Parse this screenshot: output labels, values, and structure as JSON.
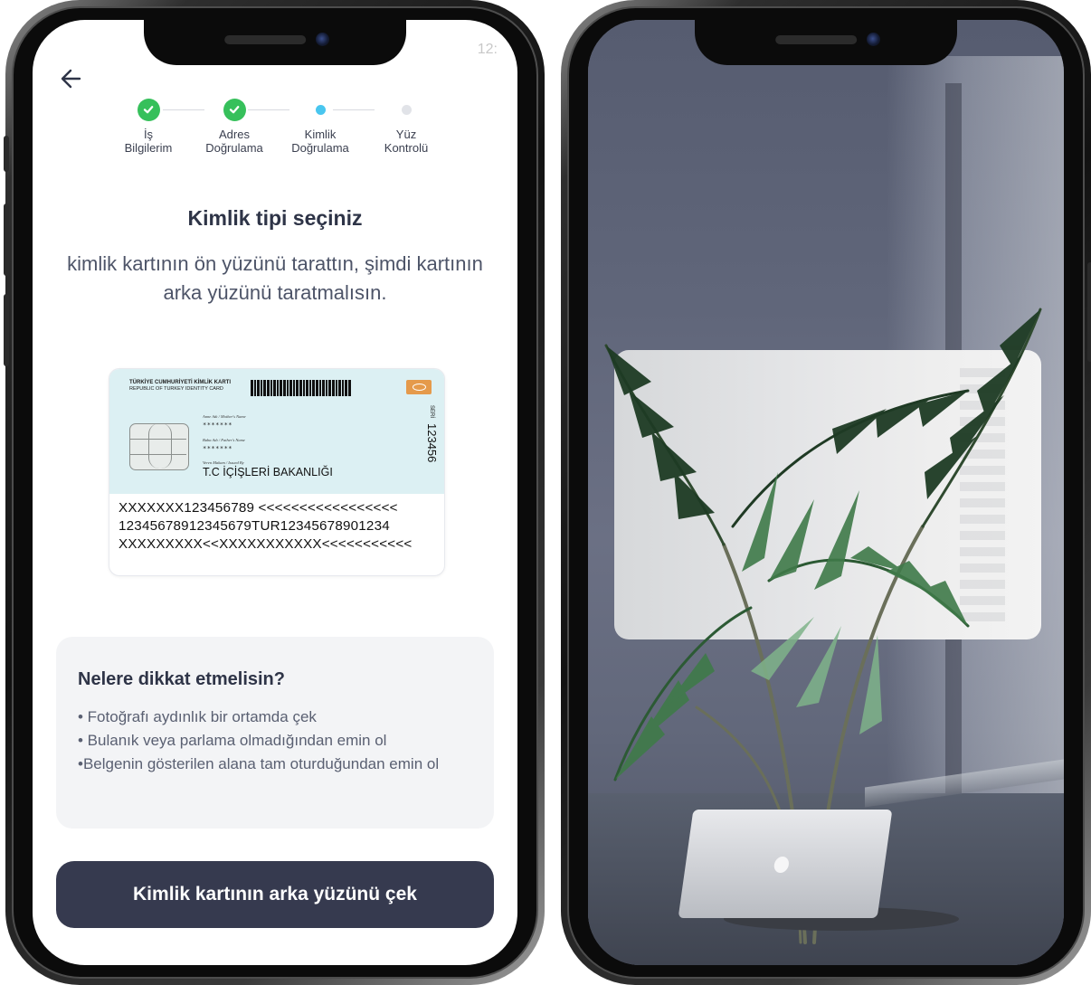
{
  "status_bar": {
    "time": "12:"
  },
  "steps": [
    {
      "label": "İş\nBilgilerim",
      "state": "done"
    },
    {
      "label": "Adres\nDoğrulama",
      "state": "done"
    },
    {
      "label": "Kimlik\nDoğrulama",
      "state": "active"
    },
    {
      "label": "Yüz\nKontrolü",
      "state": "pending"
    }
  ],
  "title": "Kimlik tipi seçiniz",
  "subtitle": "kimlik kartının ön yüzünü tarattın, şimdi kartının arka yüzünü taratmalısın.",
  "id_card": {
    "country_line1": "TÜRKİYE CUMHURİYETİ KİMLİK KARTI",
    "country_line2": "REPUBLIC OF TURKEY IDENTITY CARD",
    "mother_label": "Anne Adı / Mother's Name",
    "mother_value": "*******",
    "father_label": "Baba Adı / Father's Name",
    "father_value": "*******",
    "issuer_label": "Veren Makam / Issued By",
    "issuer_value": "T.C İÇİŞLERİ BAKANLIĞI",
    "serial_label": "SERİ",
    "serial_value": "123456",
    "mrz_line1": "XXXXXXX123456789 <<<<<<<<<<<<<<<<<",
    "mrz_line2": "12345678912345679TUR12345678901234",
    "mrz_line3": "XXXXXXXXX<<XXXXXXXXXXX<<<<<<<<<<<"
  },
  "tips": {
    "title": "Nelere dikkat etmelisin?",
    "items": [
      "• Fotoğrafı aydınlık bir ortamda çek",
      "• Bulanık veya parlama olmadığından emin ol",
      "•Belgenin gösterilen alana tam oturduğundan emin ol"
    ]
  },
  "cta": {
    "label": "Kimlik kartının arka yüzünü çek"
  },
  "colors": {
    "done": "#36c05b",
    "active": "#49c6ef",
    "pending": "#e1e3e8",
    "button": "#363a4f",
    "text_dark": "#2e3447",
    "card_bg": "#dcf0f3",
    "card_chip": "#e59a4b"
  },
  "icons": {
    "back": "arrow-left-icon",
    "done": "check-icon"
  }
}
